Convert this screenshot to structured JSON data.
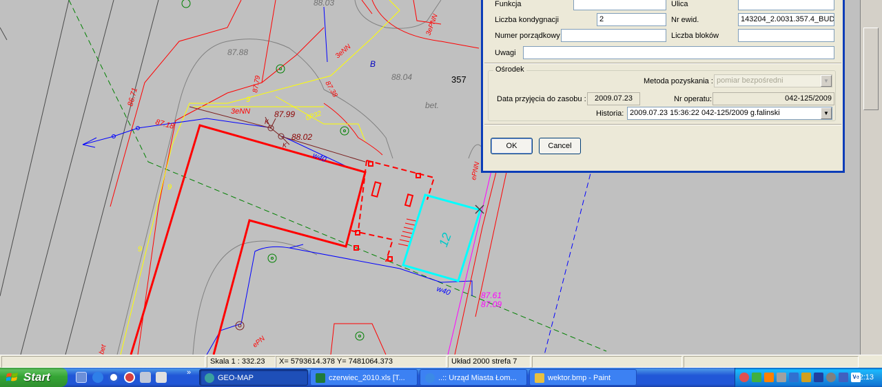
{
  "dialog": {
    "funkcja_label": "Funkcja",
    "funkcja_value": "",
    "ulica_label": "Ulica",
    "ulica_value": "",
    "liczba_kondygnacji_label": "Liczba kondygnacji",
    "liczba_kondygnacji_value": "2",
    "nr_ewid_label": "Nr ewid.",
    "nr_ewid_value": "143204_2.0031.357.4_BUD",
    "numer_porzadkowy_label": "Numer porządkowy",
    "numer_porzadkowy_value": "",
    "liczba_blokow_label": "Liczba bloków",
    "liczba_blokow_value": "",
    "uwagi_label": "Uwagi",
    "uwagi_value": "",
    "osrodek_title": "Ośrodek",
    "metoda_label": "Metoda pozyskania :",
    "metoda_value": "pomiar bezpośredni",
    "data_label": "Data przyjęcia do zasobu :",
    "data_value": "2009.07.23",
    "nr_operatu_label": "Nr operatu:",
    "nr_operatu_value": "042-125/2009",
    "historia_label": "Historia:",
    "historia_value": "2009.07.23 15:36:22 042-125/2009 g.falinski",
    "ok_label": "OK",
    "cancel_label": "Cancel"
  },
  "status_bar": {
    "scale": "Skala 1 : 332.23",
    "coords": "X= 5793614.378  Y= 7481064.373",
    "system": "Układ 2000 strefa 7"
  },
  "taskbar": {
    "start_label": "Start",
    "expand": "»",
    "items": [
      {
        "label": "GEO-MAP",
        "active": true
      },
      {
        "label": "czerwiec_2010.xls  [T..."
      },
      {
        "label": "..:: Urząd Miasta Łom..."
      },
      {
        "label": "wektor.bmp - Paint"
      }
    ],
    "clock": "12:13"
  },
  "map_labels": {
    "l1": "88.03",
    "l2": "87.88",
    "l3": "B",
    "l4": "88.04",
    "l5": "357",
    "l6": "bet.",
    "l7": "87.99",
    "l8": "88.02",
    "l9": "3eNN",
    "l10": "w40",
    "l11": "87.18",
    "l12": "86.71",
    "l13": "87.61",
    "l14": "87.09",
    "l15": "w40",
    "l16": "12",
    "l17": "ePNN",
    "l18": "3eNN",
    "l19": "3ePNN",
    "l20": "9",
    "l21": "9",
    "l22": "9",
    "l23": "0P32",
    "l24": "87.79",
    "l25": "87.38",
    "l26": "K",
    "l27": "K",
    "l28": "ePN",
    "l29": "bet"
  },
  "colors": {
    "map_bg": "#c0c0c0",
    "building": "#ff0000",
    "selected": "#00ffff",
    "water": "#0000ff",
    "gas": "#ffff00",
    "border": "#008000",
    "dialog_border": "#0a3cb8"
  }
}
